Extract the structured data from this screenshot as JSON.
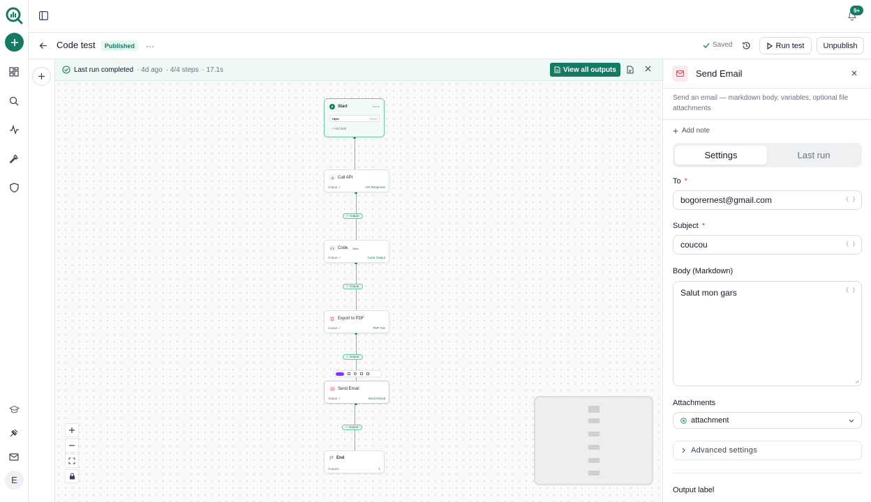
{
  "header": {
    "title": "Code test",
    "status_badge": "Published",
    "saved_label": "Saved",
    "run_test_label": "Run test",
    "unpublish_label": "Unpublish",
    "notification_count": "9+"
  },
  "run_bar": {
    "status": "Last run completed",
    "ago": "· 4d ago",
    "steps": "· 4/4 steps",
    "duration": "· 17.1s",
    "view_outputs_label": "View all outputs"
  },
  "nodes": {
    "start": {
      "title": "Start",
      "tag": "Name",
      "field_name": "repo",
      "field_type": "(Text)",
      "add_field": "+ Add field"
    },
    "call_api": {
      "title": "Call API",
      "out_left": "Output ✓",
      "out_right": "API Response"
    },
    "code": {
      "title": "Code",
      "badge": "Beta",
      "out_left": "Output ✓",
      "out_right": "Code Output"
    },
    "export_pdf": {
      "title": "Export to PDF",
      "out_left": "Output ✓",
      "out_right": "PDF File"
    },
    "send_email": {
      "title": "Send Email",
      "out_left": "Output ✓",
      "out_right": "Send Result"
    },
    "end": {
      "title": "End",
      "out_left": "Outputs",
      "out_right": "1"
    },
    "output_pill": "✓ Output"
  },
  "panel": {
    "title": "Send Email",
    "description": "Send an email — markdown body, variables, optional file attachments",
    "add_note": "Add note",
    "tabs": [
      "Settings",
      "Last run"
    ],
    "to_label": "To",
    "to_value": "bogorernest@gmail.com",
    "subject_label": "Subject",
    "subject_value": "coucou",
    "body_label": "Body (Markdown)",
    "body_value": "Salut mon gars",
    "attachments_label": "Attachments",
    "attachments_value": "attachment",
    "advanced_label": "Advanced settings",
    "output_label": "Output label",
    "var_tag": "{ }",
    "required_mark": "*"
  },
  "avatar_initial": "E",
  "colors": {
    "accent": "#157a63",
    "email_icon": "#e0425f",
    "pdf_icon": "#e0425f"
  }
}
